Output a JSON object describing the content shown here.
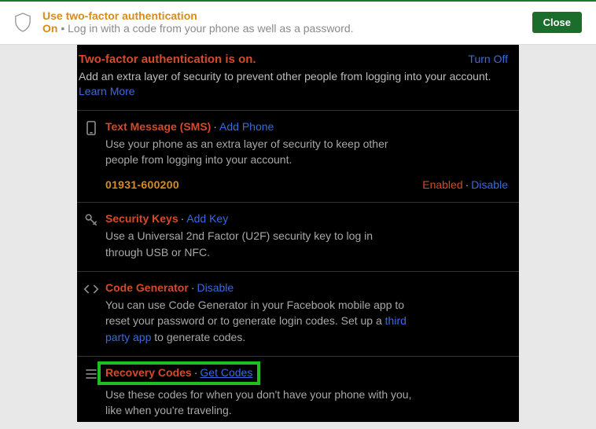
{
  "banner": {
    "title": "Use two-factor authentication",
    "on": "On",
    "desc": "Log in with a code from your phone as well as a password.",
    "close": "Close"
  },
  "header": {
    "title": "Two-factor authentication is on.",
    "turn_off": "Turn Off",
    "desc": "Add an extra layer of security to prevent other people from logging into your account. ",
    "learn_more": "Learn More"
  },
  "sms": {
    "title": "Text Message (SMS)",
    "action": "Add Phone",
    "desc": "Use your phone as an extra layer of security to keep other people from logging into your account.",
    "number": "01931-600200",
    "enabled": "Enabled",
    "disable": "Disable"
  },
  "keys": {
    "title": "Security Keys",
    "action": "Add Key",
    "desc": "Use a Universal 2nd Factor (U2F) security key to log in through USB or NFC."
  },
  "gen": {
    "title": "Code Generator",
    "action": "Disable",
    "desc1": "You can use Code Generator in your Facebook mobile app to reset your password or to generate login codes. Set up a ",
    "link": "third party app",
    "desc2": " to generate codes."
  },
  "recovery": {
    "title": "Recovery Codes",
    "action": "Get Codes",
    "desc": "Use these codes for when you don't have your phone with you, like when you're traveling."
  }
}
